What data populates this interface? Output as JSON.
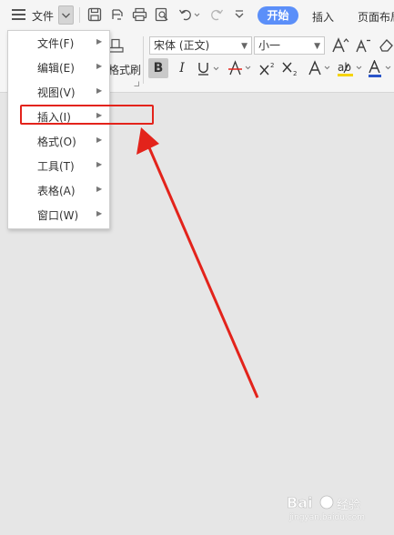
{
  "toolbar": {
    "file_label": "文件",
    "tabs": [
      {
        "label": "开始"
      },
      {
        "label": "插入"
      },
      {
        "label": "页面布局"
      }
    ],
    "format_painter_label": "格式刷",
    "font_name": "宋体 (正文)",
    "font_size": "小一",
    "icons": [
      "menu-icon",
      "save-icon",
      "export-icon",
      "print-icon",
      "print-preview-icon",
      "undo-icon",
      "redo-icon",
      "more-icon",
      "paste-brush-icon",
      "grow-font-icon",
      "shrink-font-icon",
      "clear-format-icon"
    ]
  },
  "file_menu": {
    "items": [
      {
        "label": "文件(F)"
      },
      {
        "label": "编辑(E)"
      },
      {
        "label": "视图(V)"
      },
      {
        "label": "插入(I)"
      },
      {
        "label": "格式(O)"
      },
      {
        "label": "工具(T)"
      },
      {
        "label": "表格(A)"
      },
      {
        "label": "窗口(W)"
      }
    ],
    "highlighted_index": 3
  },
  "annotation": {
    "color": "#e3231b"
  },
  "watermark": {
    "brand": "Bai",
    "suffix": "经验",
    "url": "jingyan.baidu.com"
  },
  "colors": {
    "accent": "#5b8ff9",
    "font_color_underline": "#2a55c9",
    "strike_color": "#e3231b",
    "highlight_color": "#f5d300"
  }
}
